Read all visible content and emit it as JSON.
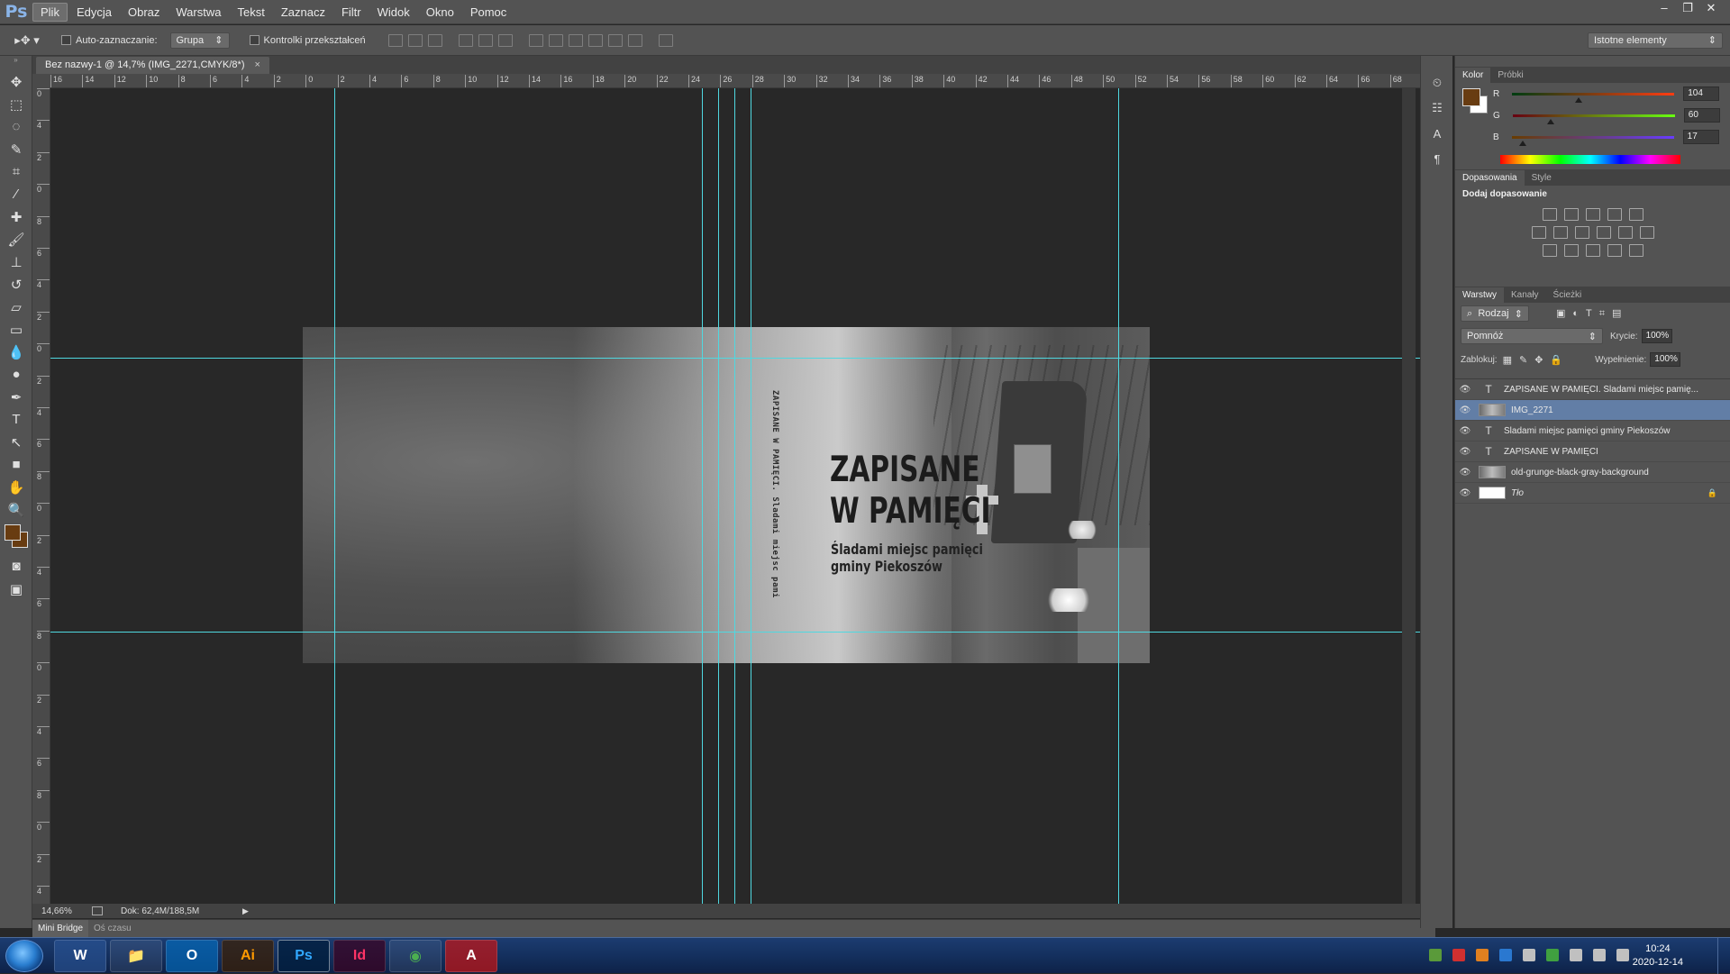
{
  "app": {
    "logo": "Ps",
    "menu": [
      "Plik",
      "Edycja",
      "Obraz",
      "Warstwa",
      "Tekst",
      "Zaznacz",
      "Filtr",
      "Widok",
      "Okno",
      "Pomoc"
    ],
    "window_controls": [
      "–",
      "❐",
      "✕"
    ]
  },
  "options_bar": {
    "auto_select_label": "Auto-zaznaczanie:",
    "auto_select_value": "Grupa",
    "transform_controls_label": "Kontrolki przekształceń",
    "workspace": "Istotne elementy"
  },
  "document": {
    "tab_title": "Bez nazwy-1 @ 14,7% (IMG_2271,CMYK/8*)",
    "tab_close": "×",
    "zoom": "14,66%",
    "doc_size": "Dok: 62,4M/188,5M",
    "ruler_top_labels": [
      "16",
      "14",
      "12",
      "10",
      "8",
      "6",
      "4",
      "2",
      "0",
      "2",
      "4",
      "6",
      "8",
      "10",
      "12",
      "14",
      "16",
      "18",
      "20",
      "22",
      "24",
      "26",
      "28",
      "30",
      "32",
      "34",
      "36",
      "38",
      "40",
      "42",
      "44",
      "46",
      "48",
      "50",
      "52",
      "54",
      "56",
      "58",
      "60",
      "62",
      "64",
      "66",
      "68"
    ],
    "ruler_left_labels": [
      "0",
      "4",
      "2",
      "0",
      "8",
      "6",
      "4",
      "2",
      "0",
      "2",
      "4",
      "6",
      "8",
      "0",
      "2",
      "4",
      "6",
      "8",
      "0",
      "2",
      "4",
      "6",
      "8",
      "0",
      "2",
      "4"
    ]
  },
  "artwork": {
    "spine_text": "ZAPISANE W PAMIĘCI. Śladami miejsc pamięci gminy Piekoszów",
    "title_line1": "ZAPISANE",
    "title_line2": "W PAMIĘCI",
    "subtitle_line1": "Śladami miejsc pamięci",
    "subtitle_line2": "gminy Piekoszów"
  },
  "bottom_tabs": [
    "Mini Bridge",
    "Oś czasu"
  ],
  "color_panel": {
    "tabs": [
      "Kolor",
      "Próbki"
    ],
    "foreground_color": "#683c11",
    "background_color": "#ffffff",
    "channels": [
      {
        "label": "R",
        "value": "104",
        "fraction": 0.408
      },
      {
        "label": "G",
        "value": "60",
        "fraction": 0.235
      },
      {
        "label": "B",
        "value": "17",
        "fraction": 0.067
      }
    ]
  },
  "adjustments_panel": {
    "tabs": [
      "Dopasowania",
      "Style"
    ],
    "heading": "Dodaj dopasowanie"
  },
  "layers_panel": {
    "tabs": [
      "Warstwy",
      "Kanały",
      "Ścieżki"
    ],
    "filter_label": "Rodzaj",
    "blend_mode": "Pomnóż",
    "opacity_label": "Krycie:",
    "opacity_value": "100%",
    "lock_label": "Zablokuj:",
    "fill_label": "Wypełnienie:",
    "fill_value": "100%",
    "layers": [
      {
        "name": "ZAPISANE W PAMIĘCI. Śladami miejsc pamię...",
        "kind": "text",
        "selected": false,
        "locked": false
      },
      {
        "name": "IMG_2271",
        "kind": "image",
        "selected": true,
        "locked": false
      },
      {
        "name": "Śladami miejsc pamięci gminy Piekoszów",
        "kind": "text",
        "selected": false,
        "locked": false
      },
      {
        "name": "ZAPISANE W PAMIĘCI",
        "kind": "text",
        "selected": false,
        "locked": false
      },
      {
        "name": "old-grunge-black-gray-background",
        "kind": "image",
        "selected": false,
        "locked": false
      },
      {
        "name": "Tło",
        "kind": "background",
        "selected": false,
        "locked": true
      }
    ]
  },
  "taskbar": {
    "apps": [
      "W",
      "📁",
      "O",
      "Ai",
      "Ps",
      "Id",
      "◉",
      "A"
    ],
    "time": "10:24",
    "date": "2020-12-14"
  }
}
